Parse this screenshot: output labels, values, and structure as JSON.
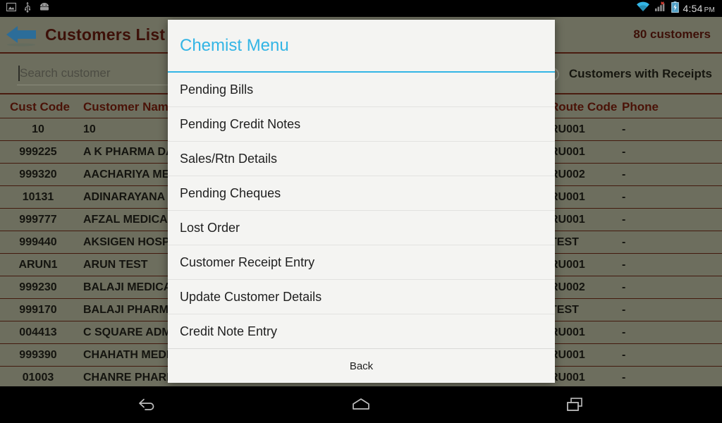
{
  "status_bar": {
    "icons_left": [
      "screenshot-icon",
      "usb-icon",
      "android-robot-icon"
    ],
    "icons_right": [
      "wifi-icon",
      "signal-no-service-icon",
      "battery-charging-icon"
    ],
    "time": "4:54",
    "ampm": "PM"
  },
  "app_bar": {
    "back_icon": "back-arrow-icon",
    "title": "Customers List",
    "customer_count": "80 customers",
    "title_color": "#3d1008",
    "background": "#6d6e5e"
  },
  "filter_row": {
    "search_placeholder": "Search customer",
    "search_value": "",
    "receipt_filter_label": "Customers with Receipts",
    "receipt_filter_selected": false
  },
  "table": {
    "columns": [
      "Cust Code",
      "Customer Name",
      "Route Code",
      "Phone"
    ],
    "rows": [
      {
        "code": "10",
        "name": "10",
        "route": "RU001",
        "phone": "-"
      },
      {
        "code": "999225",
        "name": "A K PHARMA DAVA",
        "route": "RU001",
        "phone": "-"
      },
      {
        "code": "999320",
        "name": "AACHARIYA MEDIC",
        "route": "RU002",
        "phone": "-"
      },
      {
        "code": "10131",
        "name": "ADINARAYANA ME",
        "route": "RU001",
        "phone": "-"
      },
      {
        "code": "999777",
        "name": "AFZAL MEDICALS",
        "route": "RU001",
        "phone": "-"
      },
      {
        "code": "999440",
        "name": "AKSIGEN HOSPITA",
        "route": "TEST",
        "phone": "-"
      },
      {
        "code": "ARUN1",
        "name": "ARUN TEST",
        "route": "RU001",
        "phone": "-"
      },
      {
        "code": "999230",
        "name": "BALAJI MEDICALS",
        "route": "RU002",
        "phone": "-"
      },
      {
        "code": "999170",
        "name": "BALAJI PHARMA",
        "route": "TEST",
        "phone": "-"
      },
      {
        "code": "004413",
        "name": "C SQUARE ADMIN",
        "route": "RU001",
        "phone": "-"
      },
      {
        "code": "999390",
        "name": "CHAHATH MEDICA",
        "route": "RU001",
        "phone": "-"
      },
      {
        "code": "01003",
        "name": "CHANRE PHARMA",
        "route": "RU001",
        "phone": "-"
      }
    ]
  },
  "dialog": {
    "title": "Chemist Menu",
    "accent_color": "#33b5e5",
    "items": [
      "Pending Bills",
      "Pending Credit Notes",
      "Sales/Rtn Details",
      "Pending Cheques",
      "Lost Order",
      "Customer Receipt Entry",
      "Update Customer Details",
      "Credit Note Entry"
    ],
    "back_label": "Back"
  },
  "nav_bar": {
    "buttons": [
      "nav-back-icon",
      "nav-home-icon",
      "nav-recents-icon"
    ]
  }
}
